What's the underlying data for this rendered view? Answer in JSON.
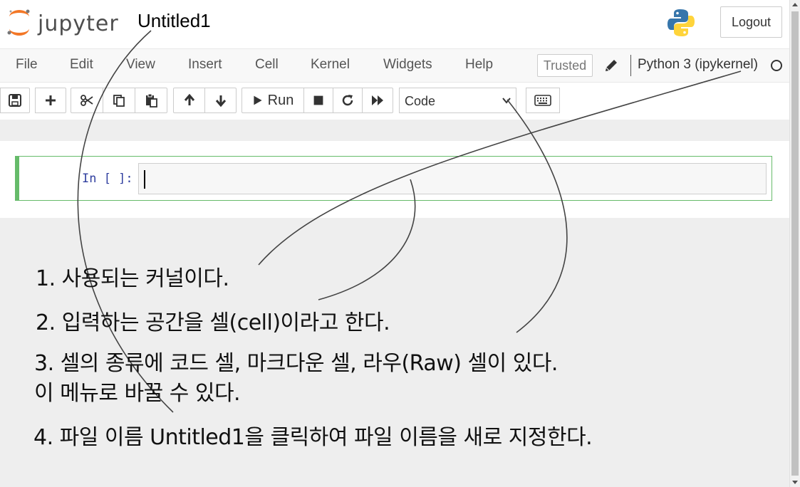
{
  "header": {
    "logo_text": "jupyter",
    "notebook_name": "Untitled1",
    "logout_label": "Logout"
  },
  "menubar": {
    "items": [
      "File",
      "Edit",
      "View",
      "Insert",
      "Cell",
      "Kernel",
      "Widgets",
      "Help"
    ],
    "trusted_label": "Trusted",
    "kernel_name": "Python 3 (ipykernel)"
  },
  "toolbar": {
    "buttons": [
      "save-icon",
      "plus-icon",
      "scissors-icon",
      "copy-icon",
      "paste-icon",
      "arrow-up-icon",
      "arrow-down-icon",
      "play-icon",
      "stop-icon",
      "restart-icon",
      "fast-forward-icon",
      "keyboard-icon"
    ],
    "run_label": "Run",
    "cell_type": "Code"
  },
  "cell": {
    "prompt": "In [ ]:",
    "content": ""
  },
  "annotations": [
    "1. 사용되는 커널이다.",
    "2. 입력하는 공간을 셀(cell)이라고 한다.",
    "3. 셀의 종류에 코드 셀,  마크다운 셀, 라우(Raw) 셀이 있다.",
    "이 메뉴로 바꿀 수 있다.",
    "4. 파일 이름 Untitled1을 클릭하여 파일 이름을 새로 지정한다."
  ],
  "colors": {
    "cell_border": "#66bb6a",
    "logo_orange": "#f37726",
    "prompt_blue": "#303f9f"
  }
}
